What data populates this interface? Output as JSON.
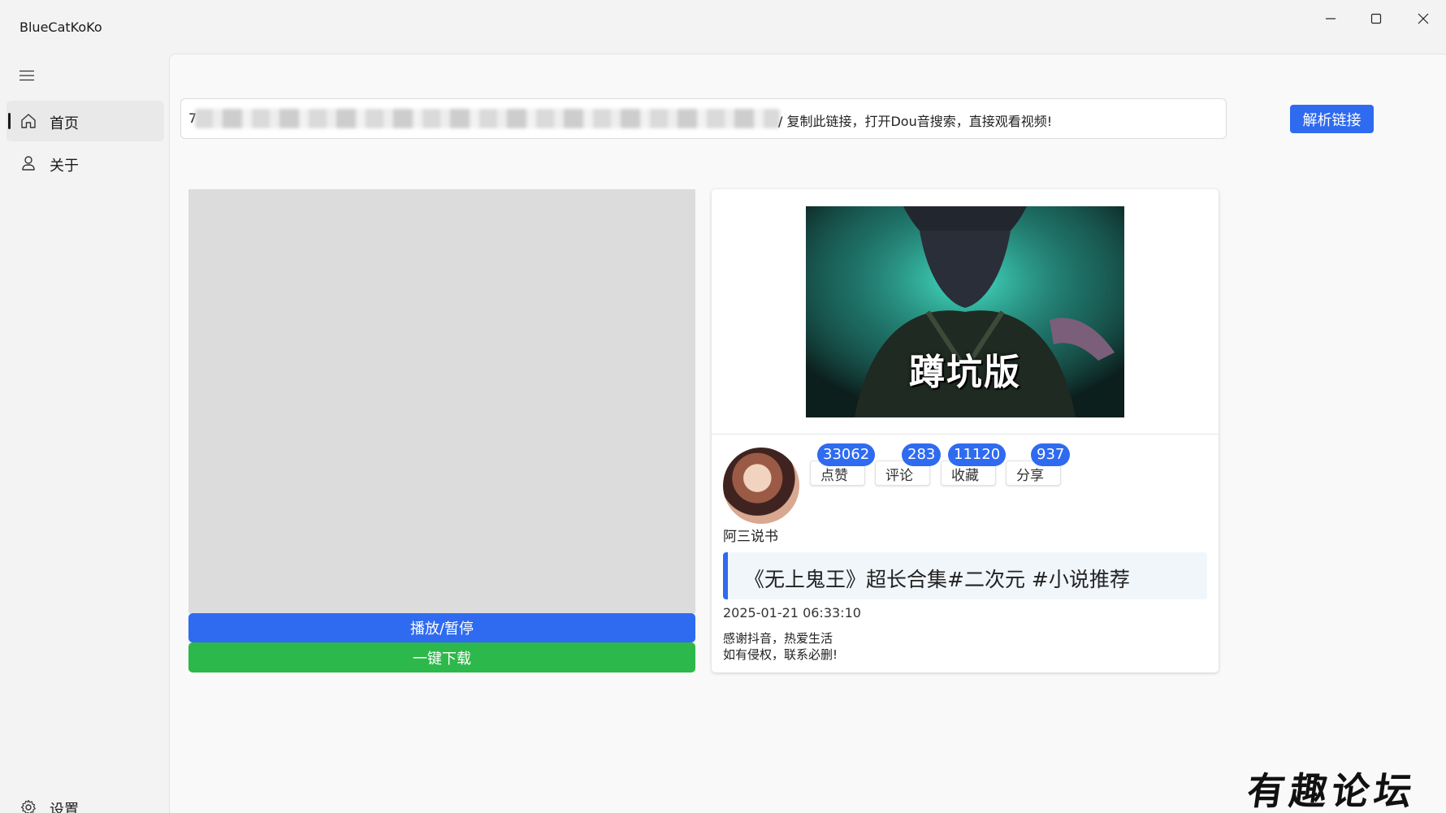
{
  "app": {
    "title": "BlueCatKoKo"
  },
  "window_controls": {
    "minimize": "minimize-icon",
    "maximize": "maximize-icon",
    "close": "close-icon"
  },
  "sidebar": {
    "menu_icon": "hamburger-icon",
    "items": [
      {
        "label": "首页",
        "icon": "home-icon",
        "active": true
      },
      {
        "label": "关于",
        "icon": "person-icon",
        "active": false
      }
    ],
    "settings": {
      "label": "设置",
      "icon": "gear-icon"
    }
  },
  "search": {
    "value_prefix": "7",
    "value_visible_tail": "/ 复制此链接，打开Dou音搜索，直接观看视频!",
    "parse_button": "解析链接"
  },
  "player": {
    "play_button": "播放/暂停",
    "download_button": "一键下载"
  },
  "video": {
    "cover_caption": "蹲坑版",
    "author": "阿三说书",
    "stats": [
      {
        "label": "点赞",
        "count": "33062"
      },
      {
        "label": "评论",
        "count": "283"
      },
      {
        "label": "收藏",
        "count": "11120"
      },
      {
        "label": "分享",
        "count": "937"
      }
    ],
    "title": "《无上鬼王》超长合集#二次元 #小说推荐",
    "date": "2025-01-21 06:33:10",
    "desc_line1": "感谢抖音，热爱生活",
    "desc_line2": "如有侵权，联系必删!"
  },
  "watermark": "有趣论坛",
  "colors": {
    "accent": "#2f6bf0",
    "download": "#2db84b",
    "video_bg": "#dcdcdc"
  }
}
